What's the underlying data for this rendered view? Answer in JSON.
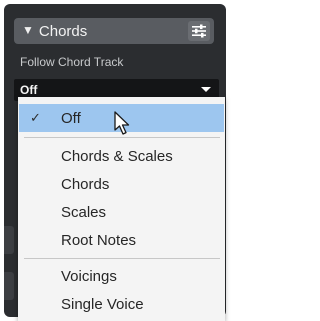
{
  "section": {
    "title": "Chords"
  },
  "follow_chord_track": {
    "label": "Follow Chord Track",
    "value": "Off"
  },
  "menu": {
    "items": [
      {
        "label": "Off",
        "checked": true
      },
      {
        "label": "Chords & Scales"
      },
      {
        "label": "Chords"
      },
      {
        "label": "Scales"
      },
      {
        "label": "Root Notes"
      },
      {
        "label": "Voicings"
      },
      {
        "label": "Single Voice"
      }
    ],
    "check_mark": "✓"
  },
  "colors": {
    "panel_bg": "#2b2d30",
    "header_bg": "#595c61",
    "menu_bg": "#f4f4f4",
    "selected_bg": "#9dc6ef"
  },
  "icons": {
    "header_caret": "caret-down-icon",
    "settings": "settings-sliders-icon",
    "dropdown": "dropdown-arrow-icon",
    "check": "checkmark-icon",
    "cursor": "mouse-pointer-icon"
  }
}
